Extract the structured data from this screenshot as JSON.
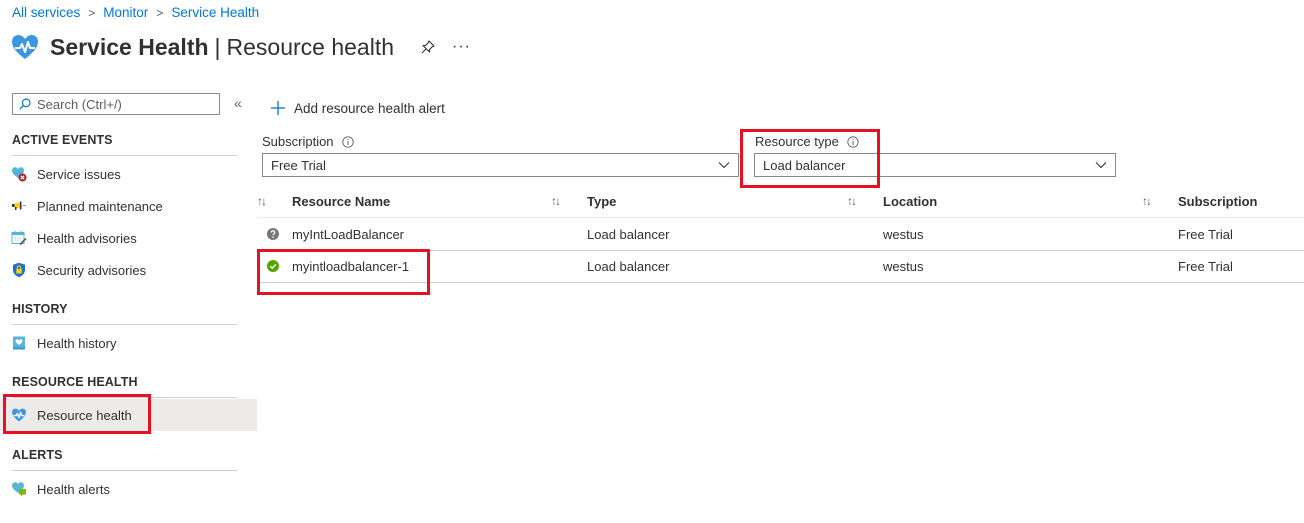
{
  "breadcrumb": [
    {
      "label": "All services"
    },
    {
      "label": "Monitor"
    },
    {
      "label": "Service Health"
    }
  ],
  "breadcrumb_separator": ">",
  "header": {
    "title": "Service Health",
    "separator": "|",
    "subtitle": "Resource health",
    "more_label": "···"
  },
  "sidebar": {
    "search_placeholder": "Search (Ctrl+/)",
    "collapse_label": "«",
    "sections": [
      {
        "title": "ACTIVE EVENTS",
        "items": [
          {
            "label": "Service issues",
            "icon": "service-issues-icon"
          },
          {
            "label": "Planned maintenance",
            "icon": "megaphone-icon"
          },
          {
            "label": "Health advisories",
            "icon": "calendar-wrench-icon"
          },
          {
            "label": "Security advisories",
            "icon": "shield-lock-icon"
          }
        ]
      },
      {
        "title": "HISTORY",
        "items": [
          {
            "label": "Health history",
            "icon": "health-book-icon"
          }
        ]
      },
      {
        "title": "RESOURCE HEALTH",
        "items": [
          {
            "label": "Resource health",
            "icon": "heart-pulse-icon",
            "selected": true
          }
        ]
      },
      {
        "title": "ALERTS",
        "items": [
          {
            "label": "Health alerts",
            "icon": "health-alert-icon"
          }
        ]
      }
    ]
  },
  "toolbar": {
    "add_alert_label": "Add resource health alert"
  },
  "filters": {
    "subscription": {
      "label": "Subscription",
      "value": "Free Trial"
    },
    "resource_type": {
      "label": "Resource type",
      "value": "Load balancer"
    }
  },
  "table": {
    "sort_glyph": "↑↓",
    "columns": [
      "Resource Name",
      "Type",
      "Location",
      "Subscription"
    ],
    "rows": [
      {
        "status": "unknown",
        "name": "myIntLoadBalancer",
        "type": "Load balancer",
        "location": "westus",
        "subscription": "Free Trial"
      },
      {
        "status": "available",
        "name": "myintloadbalancer-1",
        "type": "Load balancer",
        "location": "westus",
        "subscription": "Free Trial"
      }
    ]
  },
  "colors": {
    "link": "#0078d4",
    "highlight_box": "#e81123",
    "status_available": "#57a300",
    "status_unknown": "#797775",
    "selected_nav_bg": "#edebe9"
  }
}
